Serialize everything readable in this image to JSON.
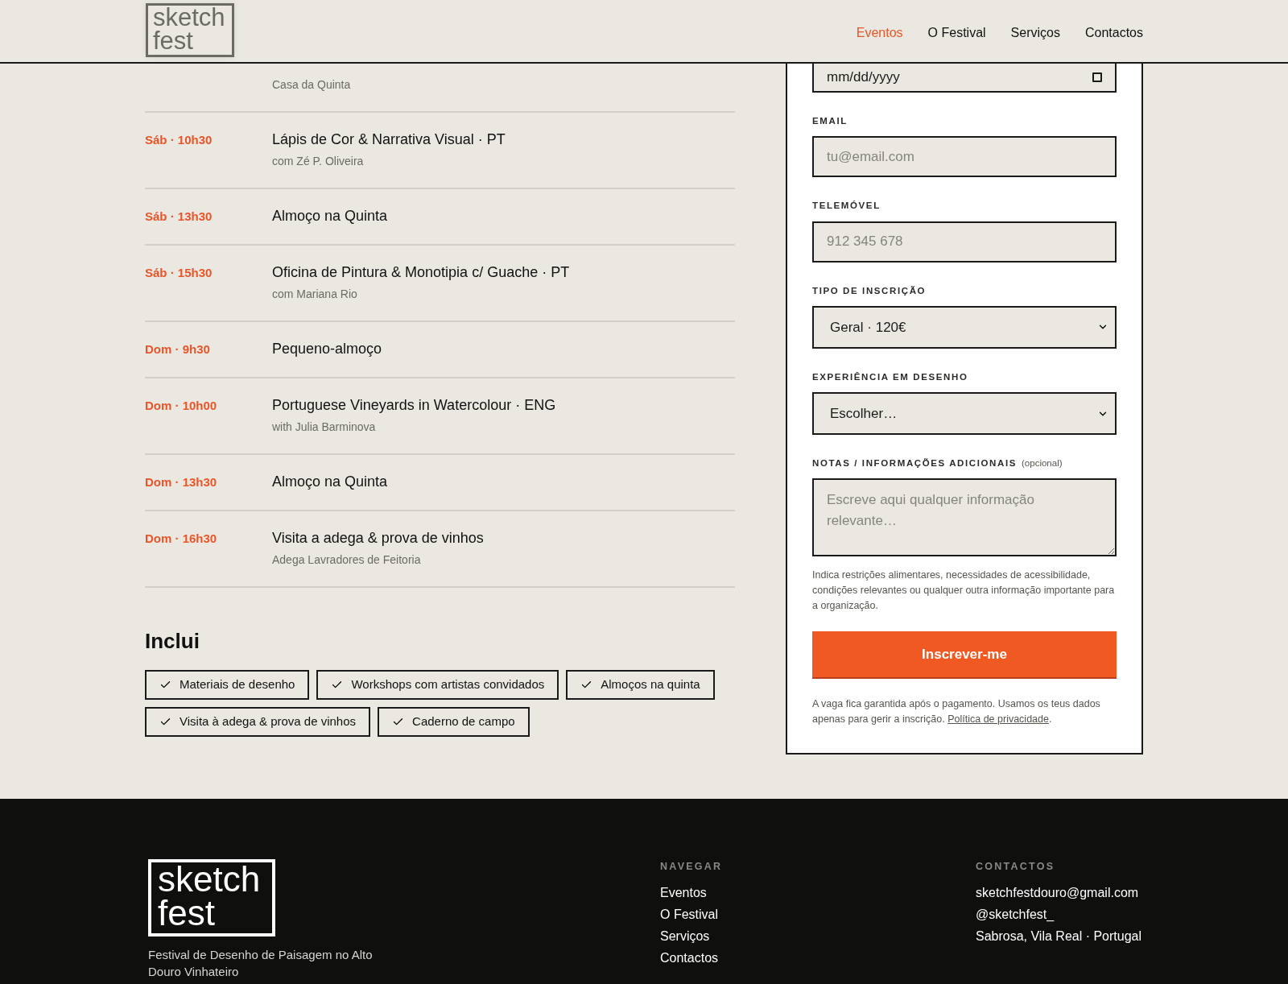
{
  "header": {
    "logo": [
      "sketch",
      "fest"
    ],
    "nav": [
      {
        "label": "Eventos",
        "selected": true
      },
      {
        "label": "O Festival",
        "selected": false
      },
      {
        "label": "Serviços",
        "selected": false
      },
      {
        "label": "Contactos",
        "selected": false
      }
    ]
  },
  "schedule": [
    {
      "subtitle": "Casa da Quinta"
    },
    {
      "time": "Sáb · 10h30",
      "title": "Lápis de Cor & Narrativa Visual · PT",
      "subtitle": "com Zé P. Oliveira"
    },
    {
      "time": "Sáb · 13h30",
      "title": "Almoço na Quinta"
    },
    {
      "time": "Sáb · 15h30",
      "title": "Oficina de Pintura & Monotipia c/ Guache · PT",
      "subtitle": "com Mariana Rio"
    },
    {
      "time": "Dom · 9h30",
      "title": "Pequeno-almoço"
    },
    {
      "time": "Dom · 10h00",
      "title": "Portuguese Vineyards in Watercolour · ENG",
      "subtitle": "with Julia Barminova"
    },
    {
      "time": "Dom · 13h30",
      "title": "Almoço na Quinta"
    },
    {
      "time": "Dom · 16h30",
      "title": "Visita a adega & prova de vinhos",
      "subtitle": "Adega Lavradores de Feitoria"
    }
  ],
  "includes": {
    "title": "Inclui",
    "items": [
      "Materiais de desenho",
      "Workshops com artistas convidados",
      "Almoços na quinta",
      "Visita à adega & prova de vinhos",
      "Caderno de campo"
    ]
  },
  "form": {
    "fields": [
      {
        "kind": "date",
        "value": "mm/dd/yyyy"
      },
      {
        "kind": "text",
        "label": "EMAIL",
        "placeholder": "tu@email.com"
      },
      {
        "kind": "text",
        "label": "TELEMÓVEL",
        "placeholder": "912 345 678"
      },
      {
        "kind": "select",
        "label": "TIPO DE INSCRIÇÃO",
        "value": "Geral · 120€"
      },
      {
        "kind": "select",
        "label": "EXPERIÊNCIA EM DESENHO",
        "value": "Escolher…"
      },
      {
        "kind": "textarea",
        "label": "NOTAS / INFORMAÇÕES ADICIONAIS",
        "hint": "(opcional)",
        "placeholder": "Escreve aqui qualquer informação relevante…",
        "help": "Indica restrições alimentares, necessidades de acessibilidade, condições relevantes ou qualquer outra informação importante para a organização."
      }
    ],
    "submit": "Inscrever-me",
    "consent": {
      "text": "A vaga fica garantida após o pagamento. Usamos os teus dados apenas para gerir a inscrição.",
      "link": "Política de privacidade",
      "end": "."
    }
  },
  "footer": {
    "logo": [
      "sketch",
      "fest"
    ],
    "tagline": "Festival de Desenho de Paisagem no Alto Douro Vinhateiro",
    "nav_title": "NAVEGAR",
    "nav": [
      "Eventos",
      "O Festival",
      "Serviços",
      "Contactos"
    ],
    "contact_title": "CONTACTOS",
    "contacts": [
      "sketchfestdouro@gmail.com",
      "@sketchfest_",
      "Sabrosa, Vila Real · Portugal"
    ]
  }
}
